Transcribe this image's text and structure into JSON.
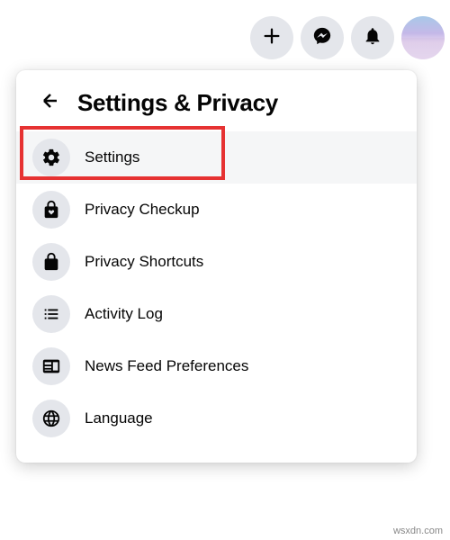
{
  "topbar": {
    "icons": [
      "plus",
      "messenger",
      "bell",
      "avatar"
    ]
  },
  "header": {
    "title": "Settings & Privacy"
  },
  "menu": {
    "items": [
      {
        "label": "Settings",
        "icon": "gear",
        "selected": true
      },
      {
        "label": "Privacy Checkup",
        "icon": "lock-heart",
        "selected": false
      },
      {
        "label": "Privacy Shortcuts",
        "icon": "lock",
        "selected": false
      },
      {
        "label": "Activity Log",
        "icon": "list",
        "selected": false
      },
      {
        "label": "News Feed Preferences",
        "icon": "feed",
        "selected": false
      },
      {
        "label": "Language",
        "icon": "globe",
        "selected": false
      }
    ]
  },
  "watermark": "wsxdn.com",
  "colors": {
    "highlight": "#e63232",
    "iconBg": "#e4e6eb",
    "text": "#050505"
  }
}
